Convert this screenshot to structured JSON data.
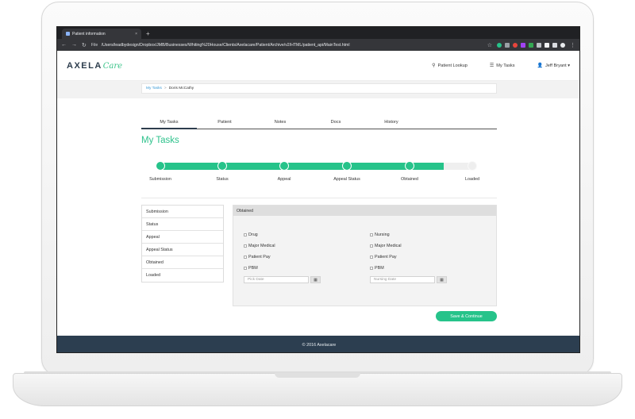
{
  "browser": {
    "tab_title": "Patient information",
    "new_tab": "+",
    "tab_close": "×",
    "file_label": "File",
    "url": "/Users/leadbydesign/Dropbox/JMB/Businesses/Whiting%20House/Clients/Axelacare/Patient/Archive/v2/HTML/patient_api/MainTest.html",
    "back": "←",
    "forward": "→",
    "reload": "↻",
    "star": "☆",
    "menu": "⋮"
  },
  "header": {
    "logo_main": "AXELA",
    "logo_accent": "Care",
    "nav": [
      {
        "icon": "⚲",
        "label": "Patient Lookup"
      },
      {
        "icon": "☰",
        "label": "My Tasks"
      },
      {
        "icon": "👤",
        "label": "Jeff Bryant ▾"
      }
    ]
  },
  "breadcrumb": {
    "link": "My Tasks",
    "sep": ">",
    "current": "Doris McCathy"
  },
  "tabs": [
    "My Tasks",
    "Patient",
    "Notes",
    "Docs",
    "History"
  ],
  "page_title": "My Tasks",
  "progress": {
    "completed_fraction": 0.9,
    "steps": [
      {
        "label": "Submission",
        "done": true
      },
      {
        "label": "Status",
        "done": true
      },
      {
        "label": "Appeal",
        "done": true
      },
      {
        "label": "Appeal Status",
        "done": true
      },
      {
        "label": "Obtained",
        "done": true
      },
      {
        "label": "Loaded",
        "done": false
      }
    ]
  },
  "side_items": [
    "Submission",
    "Status",
    "Appeal",
    "Appeal Status",
    "Obtained",
    "Loaded"
  ],
  "panel": {
    "header": "Obtained",
    "left_checks": [
      "Drug",
      "Major Medical",
      "Patient Pay",
      "PBM"
    ],
    "right_checks": [
      "Nursing",
      "Major Medical",
      "Patient Pay",
      "PBM"
    ],
    "left_date_placeholder": "Pick Date",
    "right_date_placeholder": "Nursing Date",
    "calendar_glyph": "▦"
  },
  "save_button": "Save & Continue",
  "footer": "© 2016 Axelacare",
  "colors": {
    "accent": "#26c38a",
    "footer": "#2c3e50",
    "chrome": "#35363a"
  }
}
